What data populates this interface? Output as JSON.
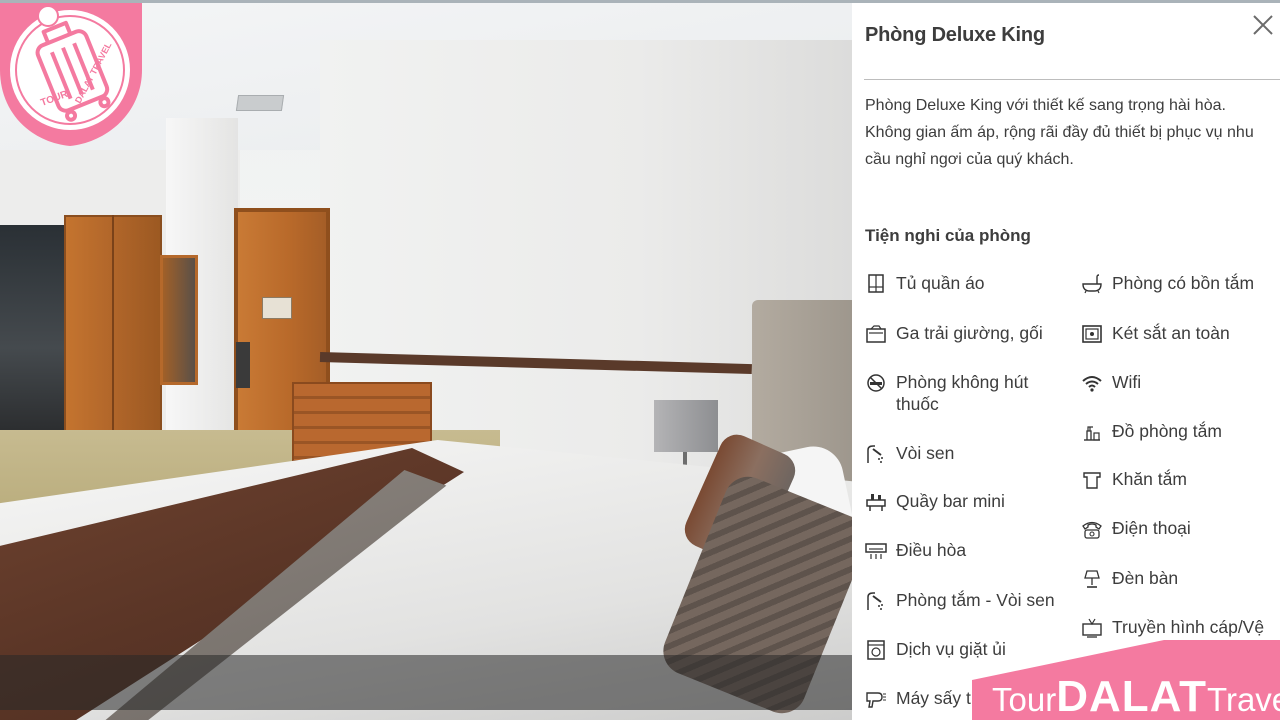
{
  "brand": {
    "logo_text": "TOUR DALAT TRAVEL",
    "promo_pre": "Tour",
    "promo_main": "DALAT",
    "promo_post": "Travel",
    "accent": "#f47aa0"
  },
  "panel": {
    "title": "Phòng Deluxe King",
    "close_icon": "close-icon",
    "description": "Phòng Deluxe King với thiết kế sang trọng hài hòa. Không gian ấm áp, rộng rãi đầy đủ thiết bị phục vụ nhu cầu nghỉ ngơi của quý khách.",
    "amenities_heading": "Tiện nghi của phòng",
    "amenities_left": [
      {
        "label": "Tủ quần áo",
        "icon": "wardrobe-icon"
      },
      {
        "label": "Ga trải giường, gối",
        "icon": "bed-linen-icon"
      },
      {
        "label": "Phòng không hút thuốc",
        "icon": "no-smoking-icon"
      },
      {
        "label": "Vòi sen",
        "icon": "shower-icon"
      },
      {
        "label": "Quầy bar mini",
        "icon": "minibar-icon"
      },
      {
        "label": "Điều hòa",
        "icon": "air-conditioner-icon"
      },
      {
        "label": "Phòng tắm - Vòi sen",
        "icon": "shower-room-icon"
      },
      {
        "label": "Dịch vụ giặt ủi",
        "icon": "laundry-icon"
      },
      {
        "label": "Máy sấy t",
        "icon": "hair-dryer-icon"
      }
    ],
    "amenities_right": [
      {
        "label": "Phòng có bồn tắm",
        "icon": "bathtub-icon"
      },
      {
        "label": "Két sắt an toàn",
        "icon": "safe-icon"
      },
      {
        "label": "Wifi",
        "icon": "wifi-icon"
      },
      {
        "label": "Đồ phòng tắm",
        "icon": "toiletries-icon"
      },
      {
        "label": "Khăn tắm",
        "icon": "towel-icon"
      },
      {
        "label": "Điện thoại",
        "icon": "telephone-icon"
      },
      {
        "label": "Đèn bàn",
        "icon": "desk-lamp-icon"
      },
      {
        "label": "Truyền hình cáp/Vệ",
        "icon": "cable-tv-icon"
      }
    ]
  }
}
